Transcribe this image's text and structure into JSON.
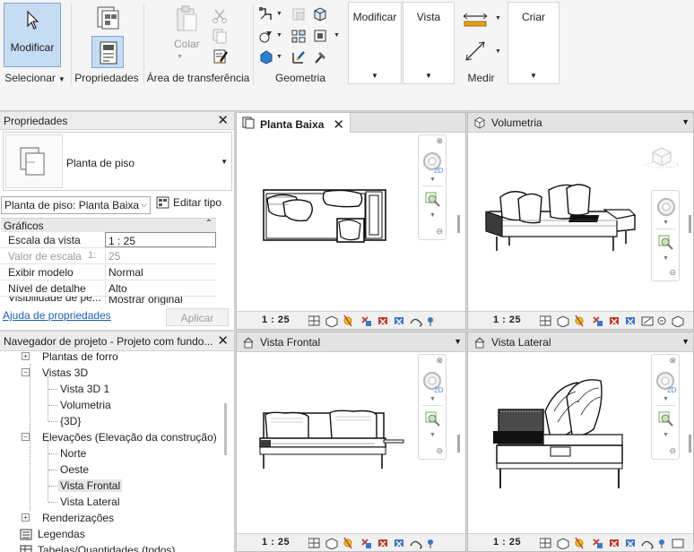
{
  "ribbon": {
    "modify_button": "Modificar",
    "panels": {
      "select": "Selecionar",
      "properties": "Propriedades",
      "clipboard": "Área de transferência",
      "geometry": "Geometria",
      "modify": "Modificar",
      "view": "Vista",
      "measure": "Medir",
      "create": "Criar"
    },
    "paste_label": "Colar"
  },
  "properties": {
    "title": "Propriedades",
    "type_name": "Planta de piso",
    "instance_selector": "Planta de piso: Planta Baixa",
    "edit_type": "Editar tipo",
    "group": "Gráficos",
    "rows": [
      {
        "key": "Escala da vista",
        "value": "1 : 25"
      },
      {
        "key": "Valor de escala",
        "prefix": "1:",
        "value": "25"
      },
      {
        "key": "Exibir modelo",
        "value": "Normal"
      },
      {
        "key": "Nível de detalhe",
        "value": "Alto"
      },
      {
        "key": "Visibilidade de pe...",
        "value": "Mostrar original"
      }
    ],
    "help_link": "Ajuda de propriedades",
    "apply_button": "Aplicar"
  },
  "browser": {
    "title": "Navegador de projeto - Projeto com fundo...",
    "nodes": [
      {
        "label": "Plantas de forro",
        "toggle": "+"
      },
      {
        "label": "Vistas 3D",
        "toggle": "−"
      },
      {
        "label": "Vista 3D 1"
      },
      {
        "label": "Volumetria"
      },
      {
        "label": "{3D}"
      },
      {
        "label": "Elevações (Elevação da construção)",
        "toggle": "−"
      },
      {
        "label": "Norte"
      },
      {
        "label": "Oeste"
      },
      {
        "label": "Vista Frontal"
      },
      {
        "label": "Vista Lateral"
      },
      {
        "label": "Renderizações",
        "toggle": "+"
      },
      {
        "label": "Legendas"
      },
      {
        "label": "Tabelas/Quantidades (todos)"
      }
    ]
  },
  "views": [
    {
      "title": "Planta Baixa",
      "scale": "1 : 25",
      "active": true,
      "close": "✕"
    },
    {
      "title": "Volumetria",
      "scale": "1 : 25"
    },
    {
      "title": "Vista Frontal",
      "scale": "1 : 25"
    },
    {
      "title": "Vista Lateral",
      "scale": "1 : 25"
    }
  ],
  "navbar": {
    "label_2d": "2D"
  },
  "colors": {
    "selection_blue": "#c5dcf3",
    "link_blue": "#1a5fb4",
    "accent": "#e3a21a"
  }
}
